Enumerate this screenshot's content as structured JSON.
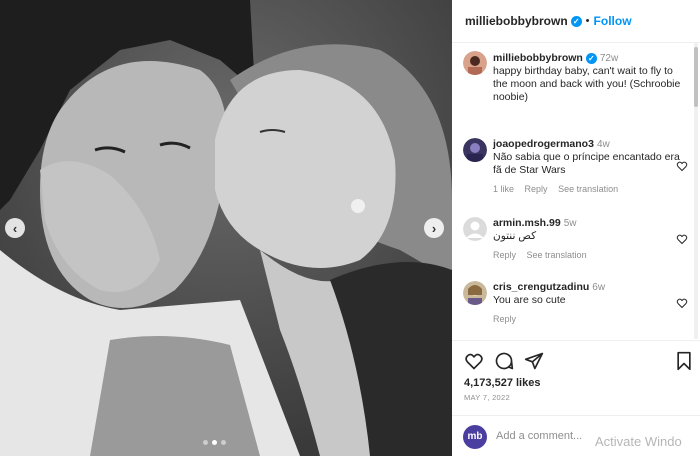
{
  "post": {
    "username": "milliebobbybrown",
    "follow_label": "Follow",
    "separator": "•"
  },
  "caption": {
    "username": "milliebobbybrown",
    "time": "72w",
    "text": "happy birthday baby, can't wait to fly to the moon and back with you! (Schroobie noobie)"
  },
  "comments": [
    {
      "username": "joaopedrogermano3",
      "time": "4w",
      "text": "Não sabia que o príncipe encantado era fã de Star Wars",
      "likes": "1 like",
      "reply": "Reply",
      "translate": "See translation"
    },
    {
      "username": "armin.msh.99",
      "time": "5w",
      "text": "کص ننتون",
      "reply": "Reply",
      "translate": "See translation"
    },
    {
      "username": "cris_crengutzadinu",
      "time": "6w",
      "text": "You are so cute",
      "reply": "Reply"
    }
  ],
  "stats": {
    "likes": "4,173,527 likes",
    "date": "MAY 7, 2022"
  },
  "add_comment": {
    "avatar_text": "mb",
    "placeholder": "Add a comment..."
  },
  "watermark": "Activate Windo",
  "carousel": {
    "slides": 3,
    "active_index": 1
  },
  "colors": {
    "accent": "#0095f6",
    "text": "#262626",
    "muted": "#8e8e8e"
  },
  "icons": [
    "chevron-left-icon",
    "chevron-right-icon",
    "verified-icon",
    "heart-icon",
    "comment-icon",
    "share-icon",
    "bookmark-icon"
  ]
}
